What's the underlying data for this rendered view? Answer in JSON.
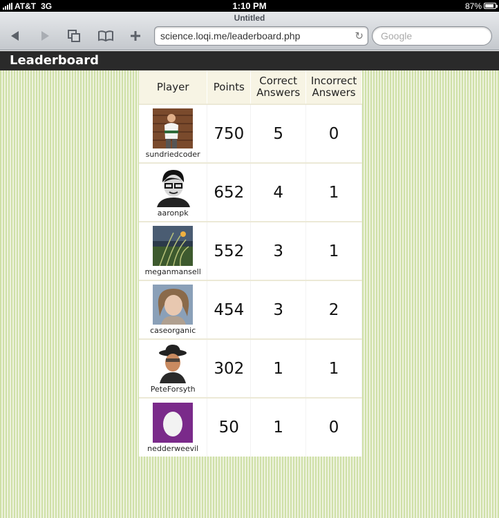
{
  "status": {
    "carrier": "AT&T",
    "network": "3G",
    "time": "1:10 PM",
    "battery": "87%",
    "battery_level": 0.87
  },
  "browser": {
    "title": "Untitled",
    "url": "science.loqi.me/leaderboard.php",
    "search_placeholder": "Google"
  },
  "app": {
    "title": "Leaderboard"
  },
  "table": {
    "headers": {
      "player": "Player",
      "points": "Points",
      "correct_1": "Correct",
      "correct_2": "Answers",
      "incorrect_1": "Incorrect",
      "incorrect_2": "Answers"
    },
    "rows": [
      {
        "name": "sundriedcoder",
        "points": "750",
        "correct": "5",
        "incorrect": "0",
        "avatar": "man-standing-photo"
      },
      {
        "name": "aaronpk",
        "points": "652",
        "correct": "4",
        "incorrect": "1",
        "avatar": "man-glasses-bw-photo"
      },
      {
        "name": "meganmansell",
        "points": "552",
        "correct": "3",
        "incorrect": "1",
        "avatar": "grass-photo"
      },
      {
        "name": "caseorganic",
        "points": "454",
        "correct": "3",
        "incorrect": "2",
        "avatar": "woman-photo"
      },
      {
        "name": "PeteForsyth",
        "points": "302",
        "correct": "1",
        "incorrect": "1",
        "avatar": "man-hat-photo"
      },
      {
        "name": "nedderweevil",
        "points": "50",
        "correct": "1",
        "incorrect": "0",
        "avatar": "default-egg-avatar"
      }
    ]
  }
}
